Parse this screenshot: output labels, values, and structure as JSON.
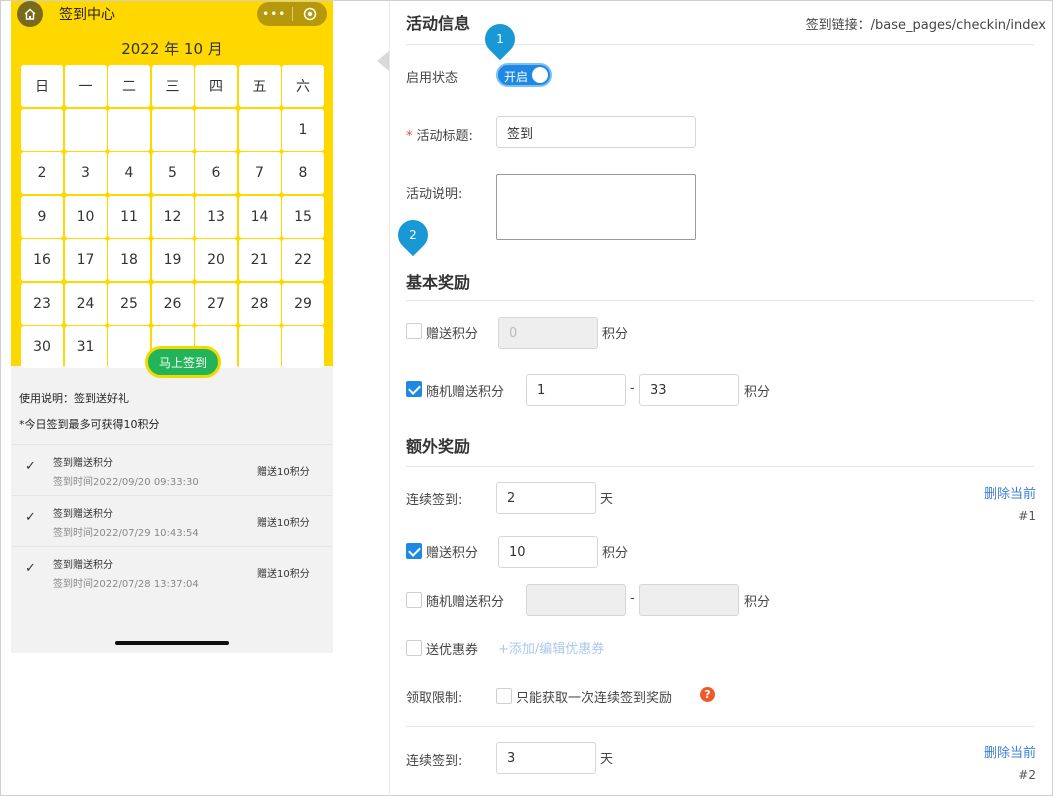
{
  "phone": {
    "nav_title": "签到中心",
    "capsule_dots": "•••",
    "month_title": "2022 年 10 月",
    "weekdays": [
      "日",
      "一",
      "二",
      "三",
      "四",
      "五",
      "六"
    ],
    "days": [
      "",
      "",
      "",
      "",
      "",
      "",
      "1",
      "2",
      "3",
      "4",
      "5",
      "6",
      "7",
      "8",
      "9",
      "10",
      "11",
      "12",
      "13",
      "14",
      "15",
      "16",
      "17",
      "18",
      "19",
      "20",
      "21",
      "22",
      "23",
      "24",
      "25",
      "26",
      "27",
      "28",
      "29",
      "30",
      "31",
      "",
      "",
      "",
      "",
      ""
    ],
    "checkin_button": "马上签到",
    "usage_note": "使用说明：签到送好礼",
    "max_note": "*今日签到最多可获得10积分",
    "records": [
      {
        "title": "签到赠送积分",
        "time": "签到时间2022/09/20 09:33:30",
        "points": "赠送10积分"
      },
      {
        "title": "签到赠送积分",
        "time": "签到时间2022/07/29 10:43:54",
        "points": "赠送10积分"
      },
      {
        "title": "签到赠送积分",
        "time": "签到时间2022/07/28 13:37:04",
        "points": "赠送10积分"
      }
    ]
  },
  "form": {
    "activity_info_title": "活动信息",
    "checkin_link": "签到链接：/base_pages/checkin/index",
    "status_label": "启用状态",
    "status_toggle_text": "开启",
    "status_on": true,
    "title_label": "活动标题:",
    "title_value": "签到",
    "desc_label": "活动说明:",
    "desc_value": "",
    "basic_reward_title": "基本奖励",
    "basic_points_label": "赠送积分",
    "basic_points_value": "0",
    "basic_points_checked": false,
    "random_points_label": "随机赠送积分",
    "random_points_checked": true,
    "random_min": "1",
    "random_max": "33",
    "points_unit": "积分",
    "range_dash": "-",
    "extra_reward_title": "额外奖励",
    "extra": [
      {
        "consecutive_label": "连续签到:",
        "consecutive_value": "2",
        "day_unit": "天",
        "delete_label": "删除当前",
        "seq": "#1",
        "points_label": "赠送积分",
        "points_checked": true,
        "points_value": "10",
        "random_label": "随机赠送积分",
        "random_checked": false,
        "coupon_label": "送优惠券",
        "coupon_checked": false,
        "coupon_link": "+添加/编辑优惠券",
        "limit_label": "领取限制:",
        "limit_option": "只能获取一次连续签到奖励",
        "limit_checked": false,
        "help_mark": "?"
      },
      {
        "consecutive_label": "连续签到:",
        "consecutive_value": "3",
        "day_unit": "天",
        "delete_label": "删除当前",
        "seq": "#2"
      }
    ]
  },
  "badges": [
    "1",
    "2"
  ],
  "colors": {
    "calendar_bg": "#ffd800",
    "checkin_button": "#23b45a",
    "primary": "#1e88e5",
    "link": "#3b7fd6",
    "help_icon": "#f05a28",
    "badge": "#1899d6"
  }
}
